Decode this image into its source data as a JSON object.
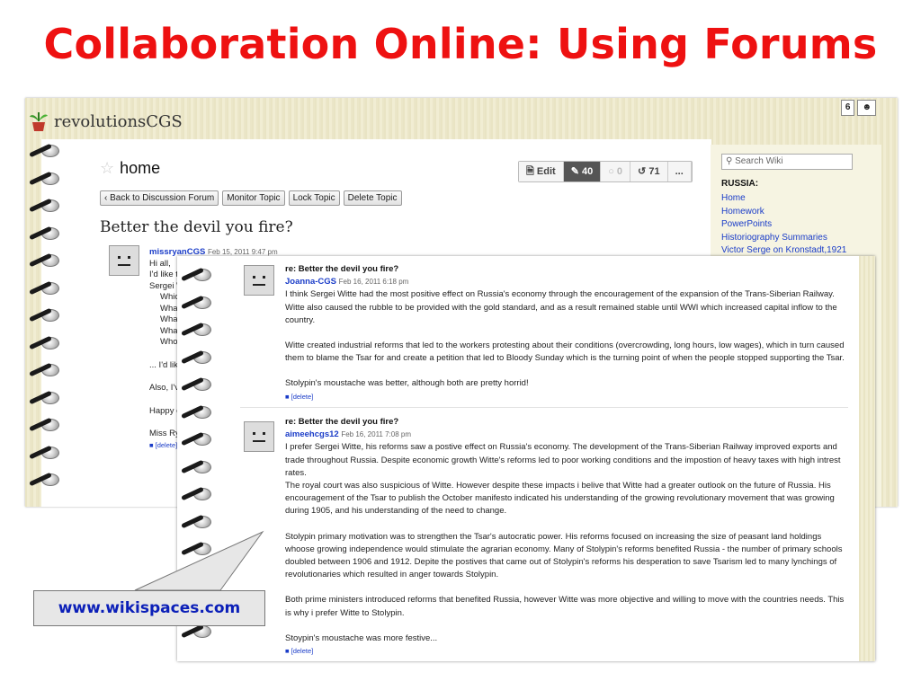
{
  "slide": {
    "title": "Collaboration Online: Using Forums"
  },
  "wiki": {
    "site_name": "revolutionsCGS",
    "counter": "6",
    "page_title": "home",
    "toolbar": {
      "edit": "Edit",
      "discussions": "40",
      "comments": "0",
      "revisions": "71",
      "more": "..."
    },
    "buttons": {
      "back": "‹ Back to Discussion Forum",
      "monitor": "Monitor Topic",
      "lock": "Lock Topic",
      "delete": "Delete Topic"
    },
    "topic_title": "Better the devil you fire?",
    "sidebar": {
      "search_placeholder": "Search Wiki",
      "heading": "RUSSIA:",
      "links": [
        "Home",
        "Homework",
        "PowerPoints",
        "Historiography Summaries",
        "Victor Serge on Kronstadt,1921"
      ]
    },
    "first_post": {
      "author": "missryanCGS",
      "timestamp": "Feb 15, 2011 9:47 pm",
      "lines": [
        "Hi all,",
        "I'd like to po",
        "Sergei Witt",
        "Which Pl",
        "What role",
        "What pol",
        "What visi",
        "Whose m",
        "... I'd like to",
        "Also, I've a",
        "Happy chat",
        "Miss Ryan"
      ],
      "delete": "[delete]"
    }
  },
  "replies": [
    {
      "subject": "re: Better the devil you fire?",
      "author": "Joanna-CGS",
      "timestamp": "Feb 16, 2011 6:18 pm",
      "paragraphs": [
        "I think Sergei Witte had the most positive effect on Russia's economy through the encouragement of the expansion of the Trans-Siberian Railway. Witte also caused the rubble to be provided with the gold standard, and as a result remained stable until WWI which increased capital inflow to the country.",
        "Witte created industrial reforms that led to the workers protesting about their conditions (overcrowding, long hours, low wages), which in turn caused them to blame the Tsar for and create a petition that led to Bloody Sunday which is the turning point of when the people stopped supporting the Tsar.",
        "Stolypin's moustache was better, although both are pretty horrid!"
      ],
      "delete": "[delete]"
    },
    {
      "subject": "re: Better the devil you fire?",
      "author": "aimeehcgs12",
      "timestamp": "Feb 16, 2011 7:08 pm",
      "paragraphs": [
        "I prefer Sergei Witte, his reforms saw a postive effect on Russia's economy. The development of the Trans-Siberian Railway improved exports and trade throughout Russia. Despite economic growth Witte's reforms led to poor working conditions and the impostion of heavy taxes with high intrest rates.",
        "The royal court was also suspicious of Witte. However despite these impacts i belive that Witte had a greater outlook on the future of Russia. His encouragement of the Tsar to publish the October manifesto indicated his understanding of the growing revolutionary movement that was growing during 1905, and his understanding of the need to change.",
        "Stolypin primary motivation was to strengthen the Tsar's autocratic power. His reforms focused on increasing the size of peasant land holdings whoose growing independence would stimulate the agrarian economy. Many of Stolypin's reforms benefited Russia - the number of primary schools doubled between 1906 and 1912. Depite the postives that came out of Stolypin's reforms his desperation to save Tsarism led to many lynchings of revolutionaries which resulted in anger towards Stolypin.",
        "Both prime ministers introduced reforms that benefited Russia, however Witte was more objective and willing to move with the countries needs. This is why i prefer Witte to Stolypin.",
        "Stoypin's moustache was more festive..."
      ],
      "delete": "[delete]"
    }
  ],
  "callout": {
    "label": "www.wikispaces.com"
  },
  "colors": {
    "title": "#ee1111",
    "link": "#1a3cc8",
    "callout_text": "#0b1fb8"
  }
}
